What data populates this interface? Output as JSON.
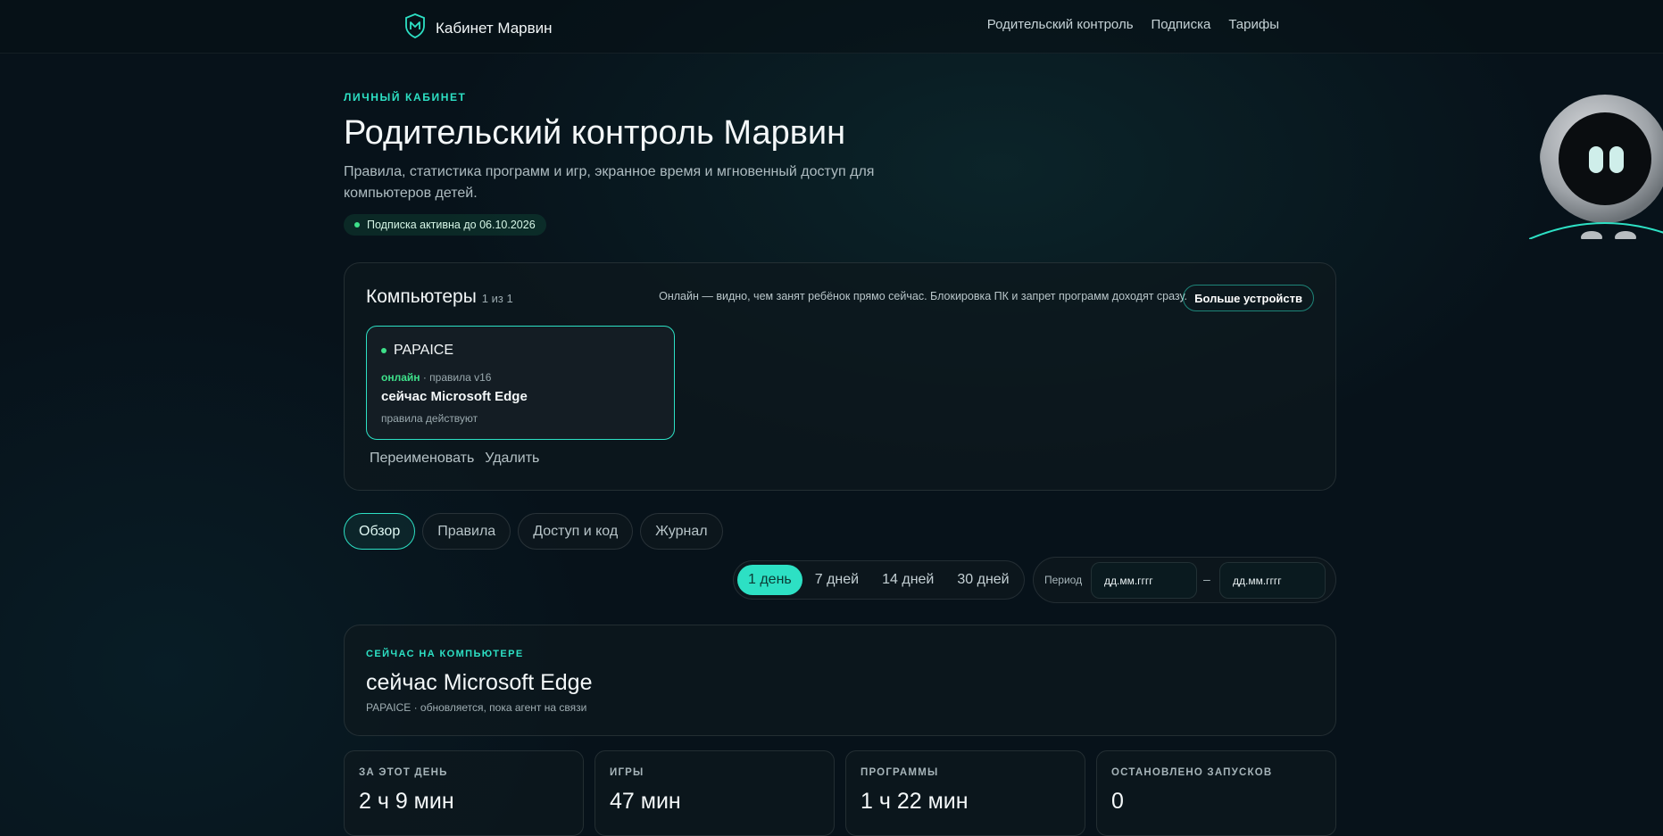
{
  "header": {
    "brand_title": "Кабинет Марвин",
    "nav": [
      "Родительский контроль",
      "Подписка",
      "Тарифы"
    ]
  },
  "hero": {
    "eyebrow": "ЛИЧНЫЙ КАБИНЕТ",
    "title": "Родительский контроль Марвин",
    "subtitle": "Правила, статистика программ и игр, экранное время и мгновенный доступ для компьютеров детей.",
    "subscription": "Подписка активна до 06.10.2026"
  },
  "computers": {
    "title": "Компьютеры",
    "count": "1 из 1",
    "hint": "Онлайн — видно, чем занят ребёнок прямо сейчас. Блокировка ПК и запрет программ доходят сразу.",
    "more_button": "Больше устройств",
    "device": {
      "name": "PAPAICE",
      "online": "онлайн",
      "rules_version": " · правила v16",
      "now": "сейчас Microsoft Edge",
      "rules_state": "правила действуют"
    },
    "actions": [
      "Переименовать",
      "Удалить"
    ]
  },
  "tabs": [
    "Обзор",
    "Правила",
    "Доступ и код",
    "Журнал"
  ],
  "range": {
    "options": [
      "1 день",
      "7 дней",
      "14 дней",
      "30 дней"
    ],
    "period_label": "Период",
    "date_placeholder": "дд.мм.гггг",
    "dash": "–"
  },
  "now_panel": {
    "eyebrow": "СЕЙЧАС НА КОМПЬЮТЕРЕ",
    "title": "сейчас Microsoft Edge",
    "subtitle": "PAPAICE · обновляется, пока агент на связи"
  },
  "stats": [
    {
      "label": "ЗА ЭТОТ ДЕНЬ",
      "value": "2 ч 9 мин"
    },
    {
      "label": "ИГРЫ",
      "value": "47 мин"
    },
    {
      "label": "ПРОГРАММЫ",
      "value": "1 ч 22 мин"
    },
    {
      "label": "ОСТАНОВЛЕНО ЗАПУСКОВ",
      "value": "0"
    }
  ],
  "colors": {
    "accent": "#2de0c4",
    "online": "#3ee08a",
    "background": "#07121a"
  }
}
